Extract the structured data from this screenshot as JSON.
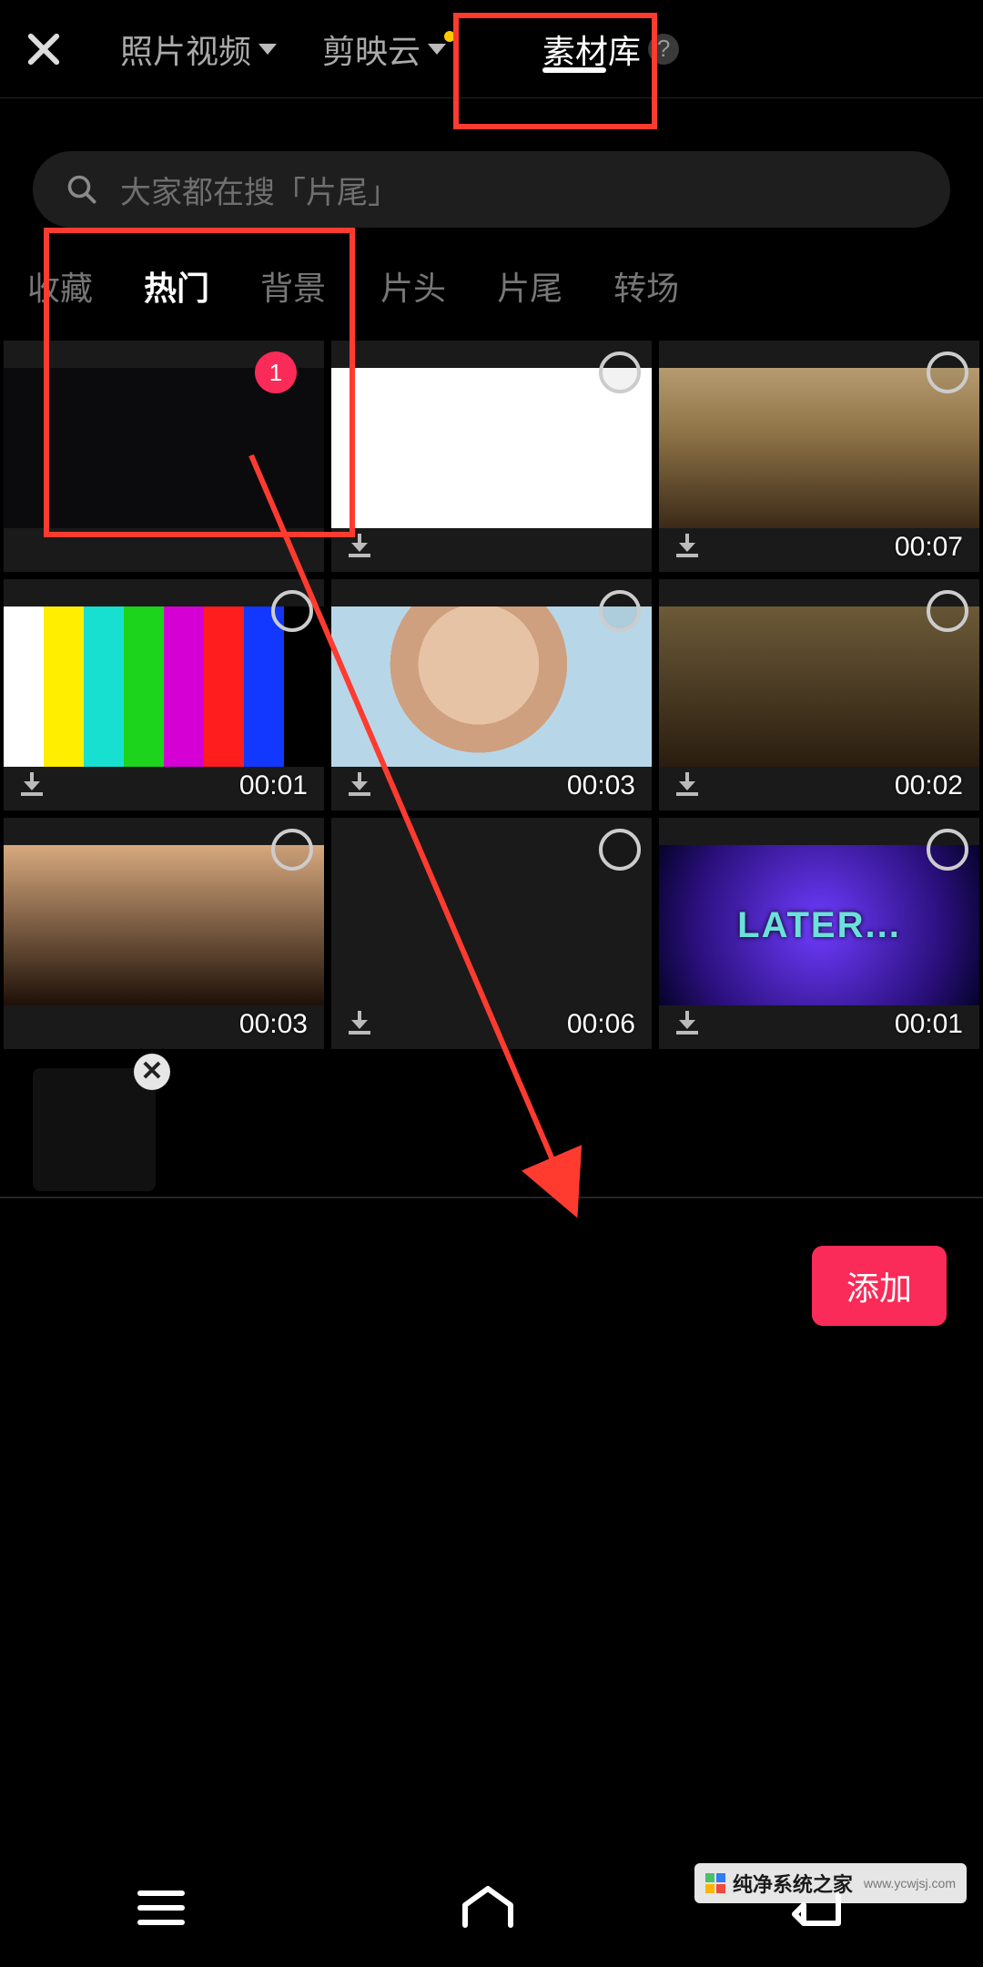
{
  "header": {
    "tabs": [
      {
        "label": "照片视频",
        "dropdown": true
      },
      {
        "label": "剪映云",
        "dropdown": true,
        "notify": true
      },
      {
        "label": "素材库",
        "help": true,
        "active": true
      }
    ]
  },
  "search": {
    "placeholder": "大家都在搜「片尾」"
  },
  "categories": [
    {
      "label": "收藏"
    },
    {
      "label": "热门",
      "active": true
    },
    {
      "label": "背景"
    },
    {
      "label": "片头"
    },
    {
      "label": "片尾"
    },
    {
      "label": "转场"
    }
  ],
  "grid": [
    {
      "selected_index": "1",
      "duration": "",
      "style": "fill-black"
    },
    {
      "duration": "",
      "style": "fill-white"
    },
    {
      "duration": "00:07",
      "style": "fill-room"
    },
    {
      "duration": "00:01",
      "style": "fill-bars"
    },
    {
      "duration": "00:03",
      "style": "fill-face1"
    },
    {
      "duration": "00:02",
      "style": "fill-crowd"
    },
    {
      "duration": "00:03",
      "style": "fill-laugh"
    },
    {
      "duration": "00:06",
      "style": "fill-paper"
    },
    {
      "duration": "00:01",
      "style": "fill-later",
      "overlay_text": "LATER..."
    }
  ],
  "tray": {
    "count": 1
  },
  "actions": {
    "add": "添加"
  },
  "help_mark": "?",
  "tray_delete": "✕",
  "watermark": {
    "brand": "纯净系统之家",
    "url": "www.ycwjsj.com"
  }
}
